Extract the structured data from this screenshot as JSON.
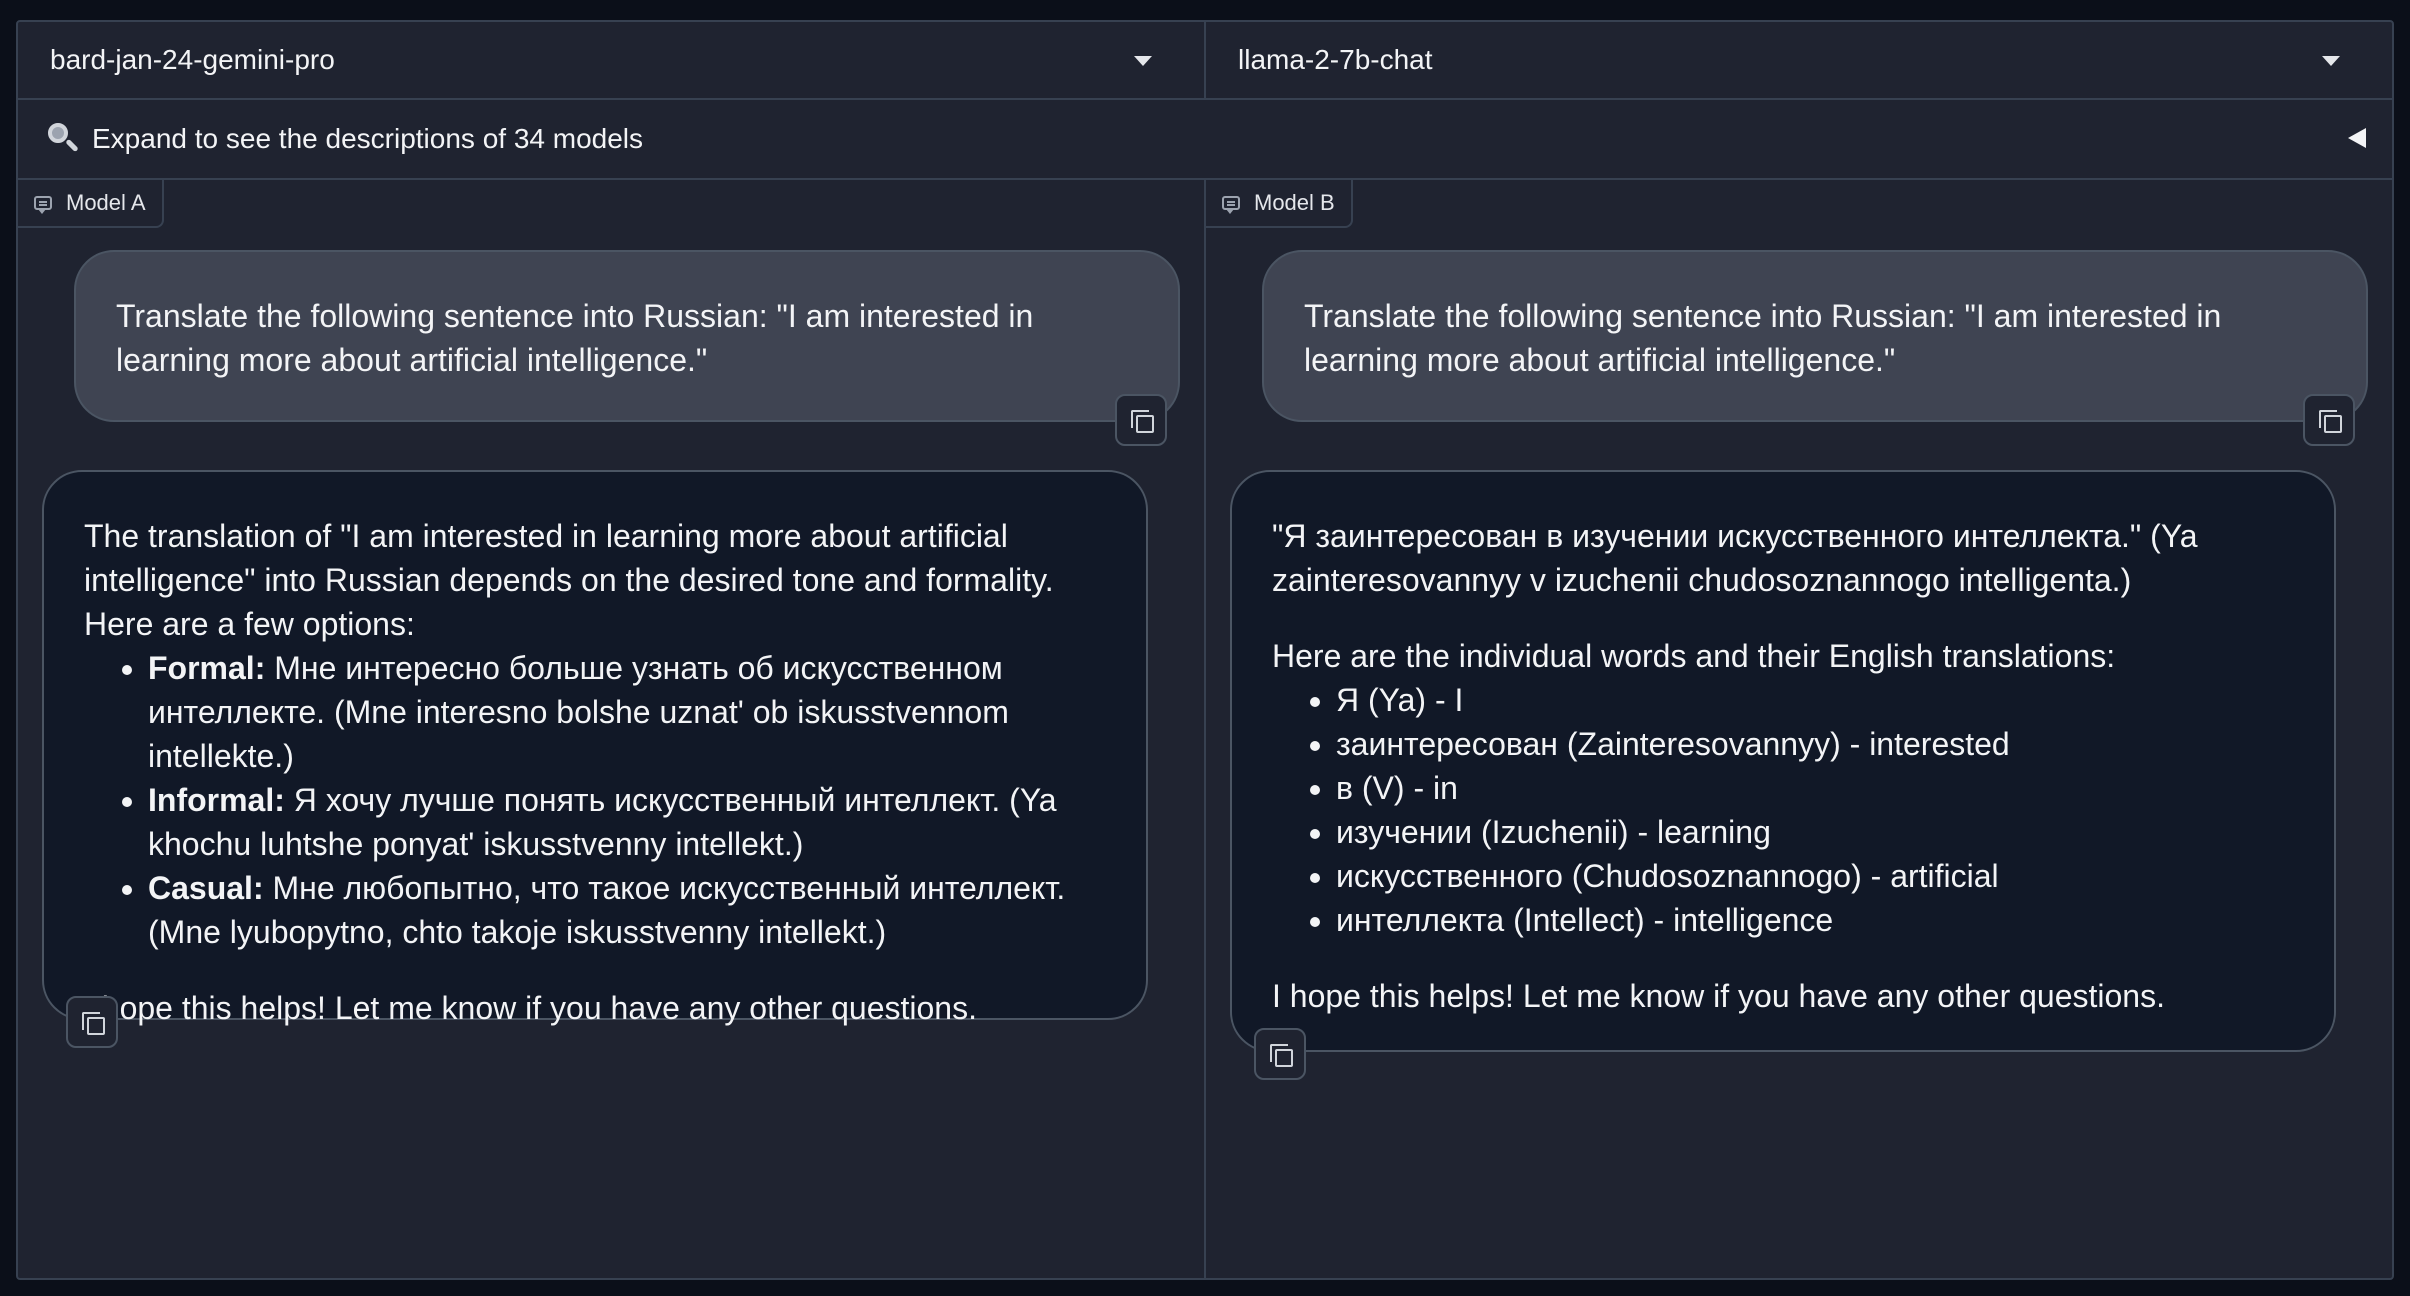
{
  "model_selectors": {
    "left": "bard-jan-24-gemini-pro",
    "right": "llama-2-7b-chat"
  },
  "accordion": {
    "icon": "magnifier-icon",
    "label": "Expand to see the descriptions of 34 models"
  },
  "panel_a": {
    "label": "Model A",
    "user_message": "Translate the following sentence into Russian: \"I am interested in learning more about artificial intelligence.\"",
    "reply": {
      "intro": "The translation of \"I am interested in learning more about artificial intelligence\" into Russian depends on the desired tone and formality. Here are a few options:",
      "options": [
        {
          "term": "Formal:",
          "text": " Мне интересно больше узнать об искусственном интеллекте. (Mne interesno bolshe uznat' ob iskusstvennom intellekte.)"
        },
        {
          "term": "Informal:",
          "text": " Я хочу лучше понять искусственный интеллект. (Ya khochu luhtshe ponyat' iskusstvenny intellekt.)"
        },
        {
          "term": "Casual:",
          "text": " Мне любопытно, что такое искусственный интеллект. (Mne lyubopytno, chto takoje iskusstvenny intellekt.)"
        }
      ],
      "outro": "I hope this helps! Let me know if you have any other questions."
    }
  },
  "panel_b": {
    "label": "Model B",
    "user_message": "Translate the following sentence into Russian: \"I am interested in learning more about artificial intelligence.\"",
    "reply": {
      "intro": "\"Я заинтересован в изучении искусственного интеллекта.\" (Ya zainteresovannyy v izuchenii chudosoznannogo intelligenta.)",
      "list_heading": "Here are the individual words and their English translations:",
      "words": [
        "Я (Ya) - I",
        "заинтересован (Zainteresovannyy) - interested",
        "в (V) - in",
        "изучении (Izuchenii) - learning",
        "искусственного (Chudosoznannogo) - artificial",
        "интеллекта (Intellect) - intelligence"
      ],
      "outro": "I hope this helps! Let me know if you have any other questions."
    }
  },
  "colors": {
    "page_bg": "#0b0f19",
    "panel_bg": "#1f2330",
    "user_bubble": "#3f4452",
    "bot_bubble": "#111827",
    "border": "#374151"
  }
}
